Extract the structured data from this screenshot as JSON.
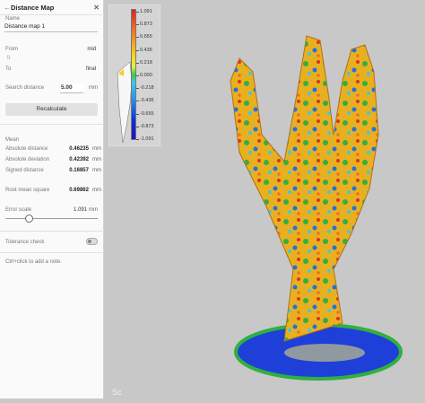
{
  "panel": {
    "title": "Distance Map",
    "name_label": "Name",
    "name_value": "Distance map 1",
    "from_label": "From",
    "from_value": "mid",
    "to_label": "To",
    "to_value": "final",
    "search_label": "Search distance",
    "search_value": "5.00",
    "search_unit": "mm",
    "recalc_label": "Recalculate",
    "mean_label": "Mean",
    "stats": [
      {
        "label": "Absolute distance",
        "value": "0.46235",
        "unit": "mm"
      },
      {
        "label": "Absolute deviation",
        "value": "0.42392",
        "unit": "mm"
      },
      {
        "label": "Signed distance",
        "value": "0.16857",
        "unit": "mm"
      }
    ],
    "rms_label": "Root mean square",
    "rms_value": "0.69862",
    "rms_unit": "mm",
    "error_label": "Error scale",
    "error_value": "1.091",
    "error_unit": "mm",
    "error_slider_fraction": 0.24,
    "tolerance_label": "Tolerance check",
    "tolerance_on": false,
    "note_hint": "Ctrl+click to add a note."
  },
  "legend": {
    "ticks": [
      "1.091",
      "0.873",
      "0.655",
      "0.436",
      "0.218",
      "0.000",
      "-0.218",
      "-0.436",
      "-0.655",
      "-0.873",
      "-1.091"
    ]
  },
  "viewport": {
    "watermark": "Sc"
  }
}
